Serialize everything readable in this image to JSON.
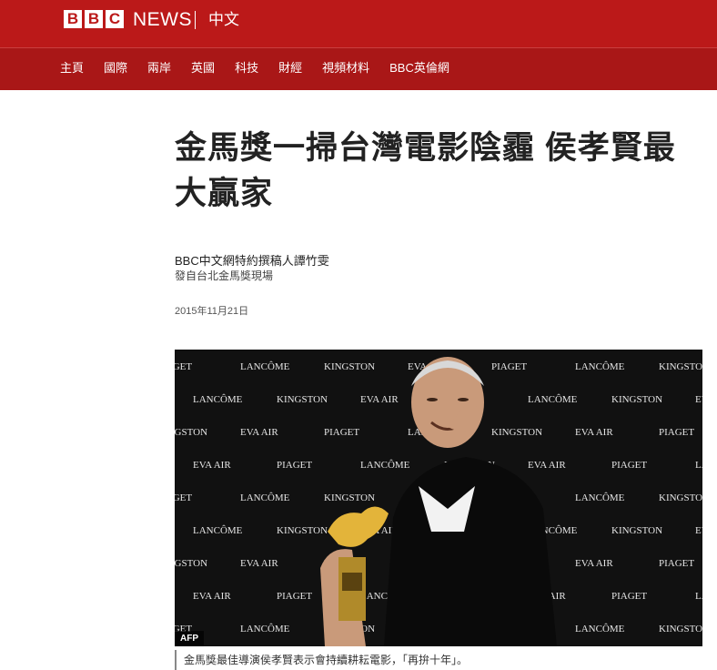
{
  "header": {
    "logo_letters": [
      "B",
      "B",
      "C"
    ],
    "news": "NEWS",
    "language": "中文",
    "brand_color": "#bb1919"
  },
  "nav": {
    "items": [
      "主頁",
      "國際",
      "兩岸",
      "英國",
      "科技",
      "財經",
      "視頻材料",
      "BBC英倫網"
    ]
  },
  "article": {
    "headline": "金馬獎一掃台灣電影陰霾 侯孝賢最大贏家",
    "byline_name": "BBC中文網特約撰稿人譚竹雯",
    "byline_role": "發自台北金馬獎現場",
    "date": "2015年11月21日"
  },
  "photo": {
    "credit": "AFP",
    "caption": "金馬獎最佳導演侯孝賢表示會持續耕耘電影，「再拚十年」。",
    "backdrop_logos": [
      "PIAGET",
      "LANCÔME",
      "KINGSTON",
      "EVA AIR"
    ]
  }
}
